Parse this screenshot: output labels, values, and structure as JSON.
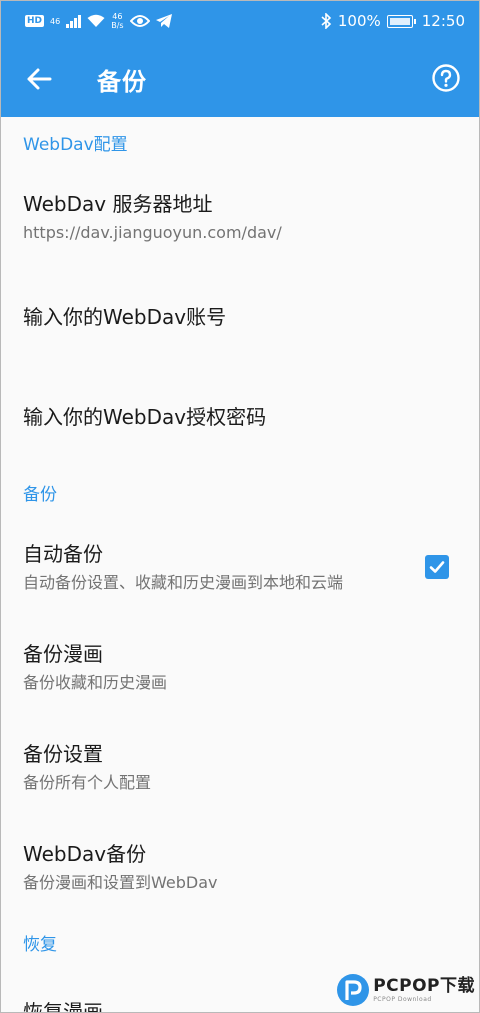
{
  "status_bar": {
    "hd": "HD",
    "net_type": "46",
    "net_speed_value": "46",
    "net_speed_unit": "B/s",
    "battery": "100%",
    "time": "12:50"
  },
  "app_bar": {
    "title": "备份"
  },
  "sections": {
    "webdav": {
      "header": "WebDav配置",
      "server": {
        "title": "WebDav 服务器地址",
        "summary": "https://dav.jianguoyun.com/dav/"
      },
      "account": {
        "title": "输入你的WebDav账号"
      },
      "password": {
        "title": "输入你的WebDav授权密码"
      }
    },
    "backup": {
      "header": "备份",
      "auto": {
        "title": "自动备份",
        "summary": "自动备份设置、收藏和历史漫画到本地和云端",
        "checked": true
      },
      "comics": {
        "title": "备份漫画",
        "summary": "备份收藏和历史漫画"
      },
      "settings": {
        "title": "备份设置",
        "summary": "备份所有个人配置"
      },
      "webdav": {
        "title": "WebDav备份",
        "summary": "备份漫画和设置到WebDav"
      }
    },
    "restore": {
      "header": "恢复",
      "comics": {
        "title": "恢复漫画"
      }
    }
  },
  "watermark": {
    "main": "PCPOP下载",
    "sub": "PCPOP Download"
  },
  "colors": {
    "accent": "#2f95e8",
    "background": "#fafafa",
    "title_text": "#1b1b1b",
    "summary_text": "#737373"
  }
}
